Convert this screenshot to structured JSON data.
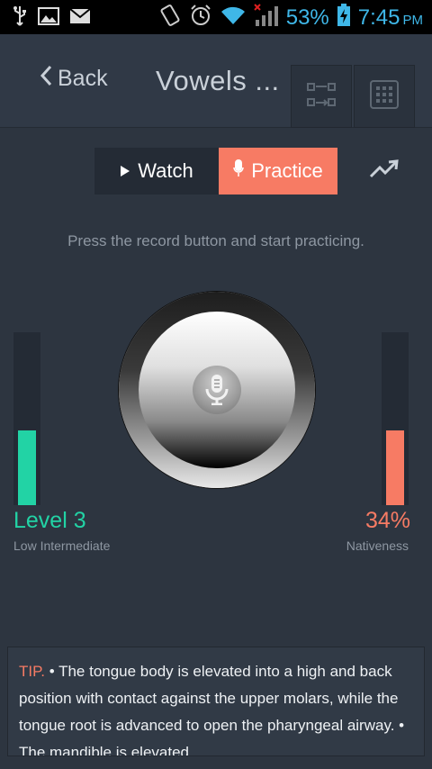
{
  "status_bar": {
    "battery_percent": "53%",
    "time": "7:45",
    "ampm": "PM"
  },
  "app_bar": {
    "back_label": "Back",
    "title": "Vowels ..."
  },
  "mode_toggle": {
    "watch_label": "Watch",
    "practice_label": "Practice",
    "selected": "Practice"
  },
  "instruction": "Press the record button and start practicing.",
  "level": {
    "value": "Level 3",
    "label": "Low Intermediate",
    "fill_fraction": 0.43
  },
  "nativeness": {
    "value": "34%",
    "label": "Nativeness",
    "fill_fraction": 0.43
  },
  "tip": {
    "label": "TIP.",
    "text": " • The tongue body is elevated into a high and back position with contact against the upper molars, while the tongue root is advanced to open the pharyngeal airway. • The mandible is elevated."
  },
  "colors": {
    "accent": "#f77b64",
    "level": "#22d3a5",
    "status": "#3fb7e8",
    "background": "#2d3540"
  },
  "icons": [
    "usb-icon",
    "image-icon",
    "mail-icon",
    "vibrate-icon",
    "alarm-icon",
    "wifi-icon",
    "signal-icon",
    "battery-icon",
    "chevron-left-icon",
    "swap-icon",
    "keypad-icon",
    "play-icon",
    "mic-icon",
    "trend-icon"
  ]
}
